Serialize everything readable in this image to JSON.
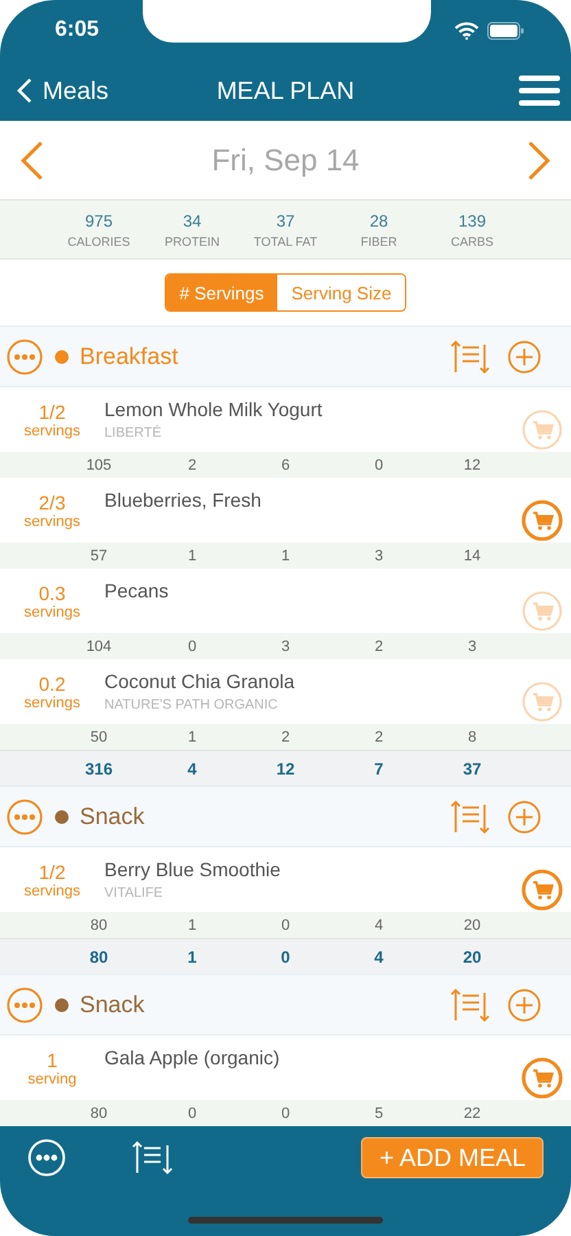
{
  "status_bar": {
    "time": "6:05"
  },
  "nav": {
    "back": "Meals",
    "title": "MEAL PLAN"
  },
  "date": "Fri, Sep 14",
  "summary": [
    {
      "value": "975",
      "label": "CALORIES"
    },
    {
      "value": "34",
      "label": "PROTEIN"
    },
    {
      "value": "37",
      "label": "TOTAL FAT"
    },
    {
      "value": "28",
      "label": "FIBER"
    },
    {
      "value": "139",
      "label": "CARBS"
    }
  ],
  "toggle": [
    {
      "label": "# Servings",
      "selected": true
    },
    {
      "label": "Serving Size",
      "selected": false
    }
  ],
  "meals": [
    {
      "name": "Breakfast",
      "color": "#f28a1c",
      "items": [
        {
          "amount": "1/2",
          "unit": "servings",
          "name": "Lemon Whole Milk Yogurt",
          "brand": "LIBERTÉ",
          "in_cart": false,
          "nutrients": [
            "105",
            "2",
            "6",
            "0",
            "12"
          ]
        },
        {
          "amount": "2/3",
          "unit": "servings",
          "name": "Blueberries, Fresh",
          "in_cart": true,
          "nutrients": [
            "57",
            "1",
            "1",
            "3",
            "14"
          ]
        },
        {
          "amount": "0.3",
          "unit": "servings",
          "name": "Pecans",
          "in_cart": false,
          "nutrients": [
            "104",
            "0",
            "3",
            "2",
            "3"
          ]
        },
        {
          "amount": "0.2",
          "unit": "servings",
          "name": "Coconut Chia Granola",
          "brand": "NATURE'S PATH ORGANIC",
          "in_cart": false,
          "nutrients": [
            "50",
            "1",
            "2",
            "2",
            "8"
          ]
        }
      ],
      "totals": [
        "316",
        "4",
        "12",
        "7",
        "37"
      ]
    },
    {
      "name": "Snack",
      "color": "#9a6a3a",
      "items": [
        {
          "amount": "1/2",
          "unit": "servings",
          "name": "Berry Blue Smoothie",
          "brand": "VITALIFE",
          "in_cart": true,
          "nutrients": [
            "80",
            "1",
            "0",
            "4",
            "20"
          ]
        }
      ],
      "totals": [
        "80",
        "1",
        "0",
        "4",
        "20"
      ]
    },
    {
      "name": "Snack",
      "color": "#9a6a3a",
      "items": [
        {
          "amount": "1",
          "unit": "serving",
          "name": "Gala Apple (organic)",
          "in_cart": true,
          "nutrients": [
            "80",
            "0",
            "0",
            "5",
            "22"
          ]
        }
      ]
    }
  ],
  "bottom_bar": {
    "add_button": "+ ADD MEAL"
  }
}
